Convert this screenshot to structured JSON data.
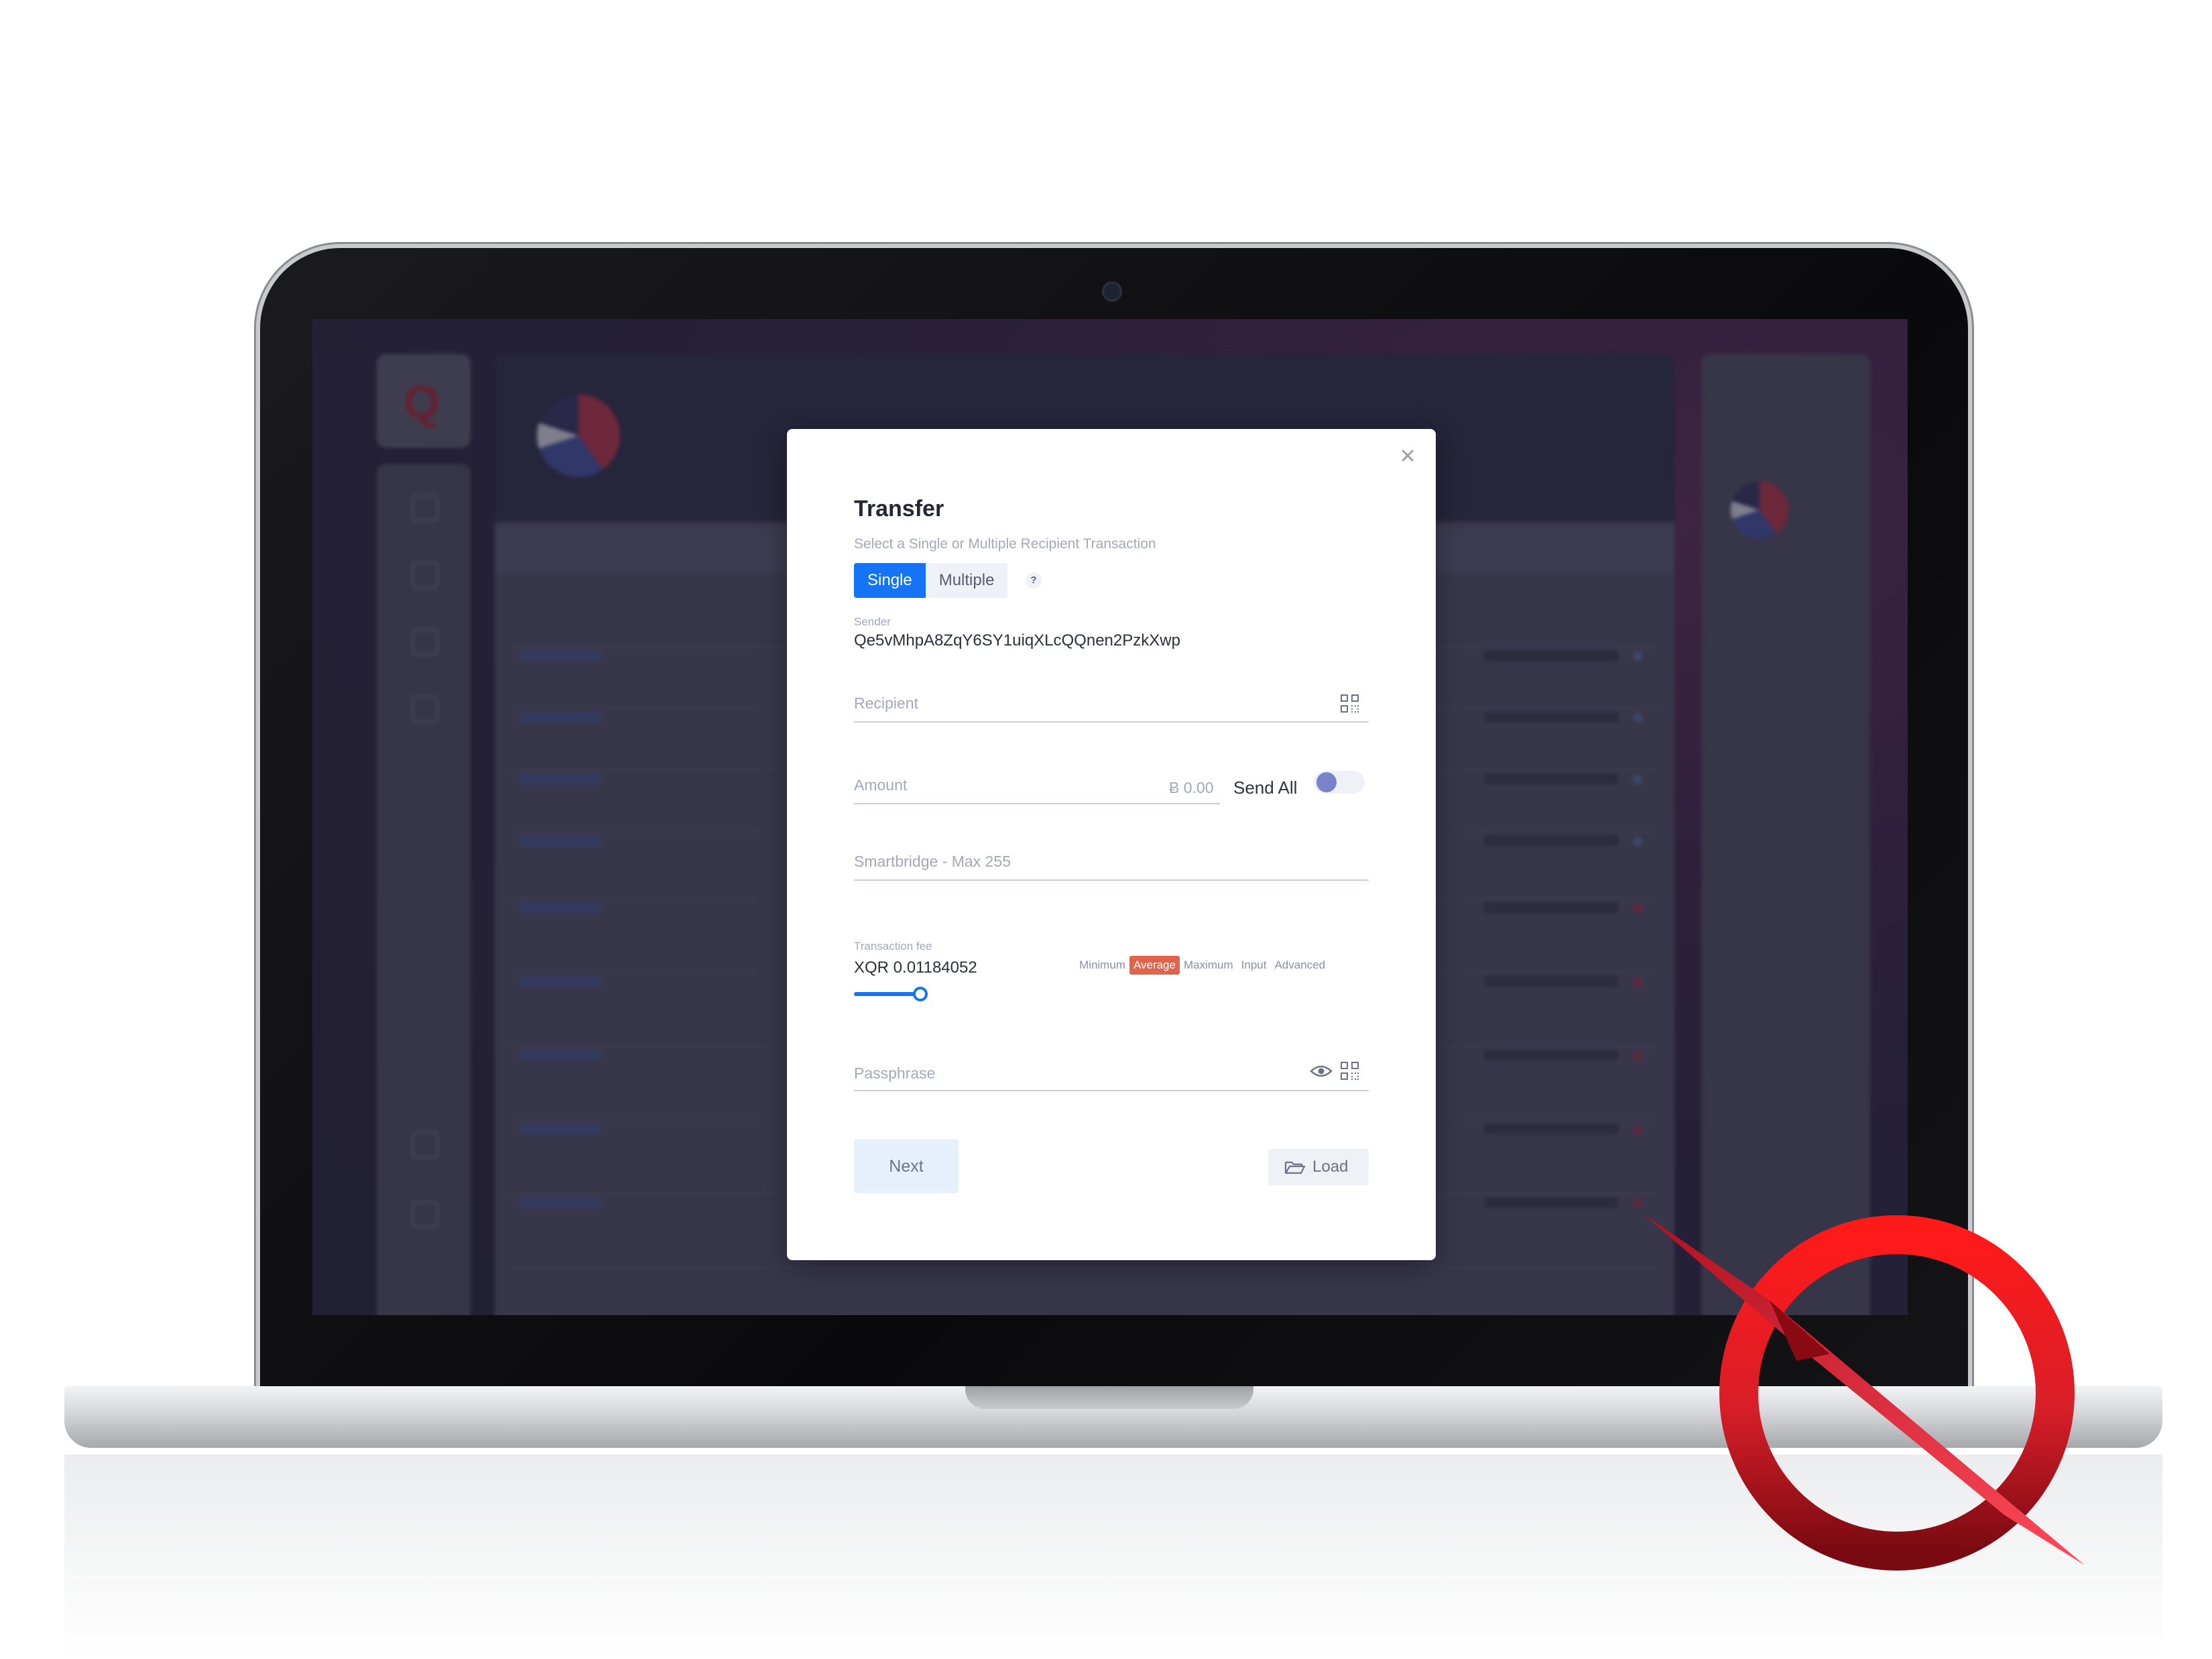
{
  "modal": {
    "title": "Transfer",
    "subtitle": "Select a Single or Multiple Recipient Transaction",
    "close_icon": "close-icon",
    "tabs": {
      "single": "Single",
      "multiple": "Multiple",
      "help": "?"
    },
    "sender": {
      "label": "Sender",
      "value": "Qe5vMhpA8ZqY6SY1uiqXLcQQnen2PzkXwp"
    },
    "recipient": {
      "placeholder": "Recipient",
      "icon": "qr-code-icon"
    },
    "amount": {
      "placeholder": "Amount",
      "value": "Ƀ 0.00",
      "send_all_label": "Send All",
      "send_all_enabled": false
    },
    "smartbridge": {
      "placeholder": "Smartbridge - Max 255"
    },
    "fee": {
      "label": "Transaction fee",
      "value": "XQR 0.01184052",
      "options": [
        "Minimum",
        "Average",
        "Maximum",
        "Input",
        "Advanced"
      ],
      "selected": "Average",
      "selected_color": "#e0634a",
      "slider_level": 0.12
    },
    "passphrase": {
      "placeholder": "Passphrase"
    },
    "buttons": {
      "next": "Next",
      "load": "Load"
    }
  },
  "colors": {
    "accent": "#1574f5",
    "brand_red": "#d81e28"
  }
}
